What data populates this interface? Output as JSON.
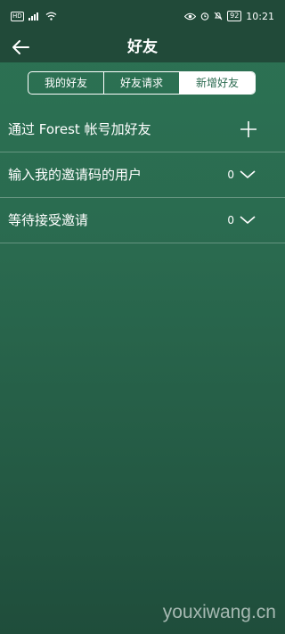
{
  "status_bar": {
    "network_badge": "HD",
    "battery": "92",
    "time": "10:21"
  },
  "header": {
    "title": "好友"
  },
  "tabs": [
    {
      "label": "我的好友",
      "active": false
    },
    {
      "label": "好友请求",
      "active": false
    },
    {
      "label": "新增好友",
      "active": true
    }
  ],
  "rows": [
    {
      "label": "通过 Forest 帐号加好友",
      "count": "",
      "icon": "plus-icon"
    },
    {
      "label": "输入我的邀请码的用户",
      "count": "0",
      "icon": "chevron-down-icon"
    },
    {
      "label": "等待接受邀请",
      "count": "0",
      "icon": "chevron-down-icon"
    }
  ],
  "watermark": "youxiwang.cn",
  "colors": {
    "background": "#2a6a4f",
    "header": "#214a39",
    "active_tab_bg": "#ffffff",
    "active_tab_text": "#2a6a4f"
  }
}
